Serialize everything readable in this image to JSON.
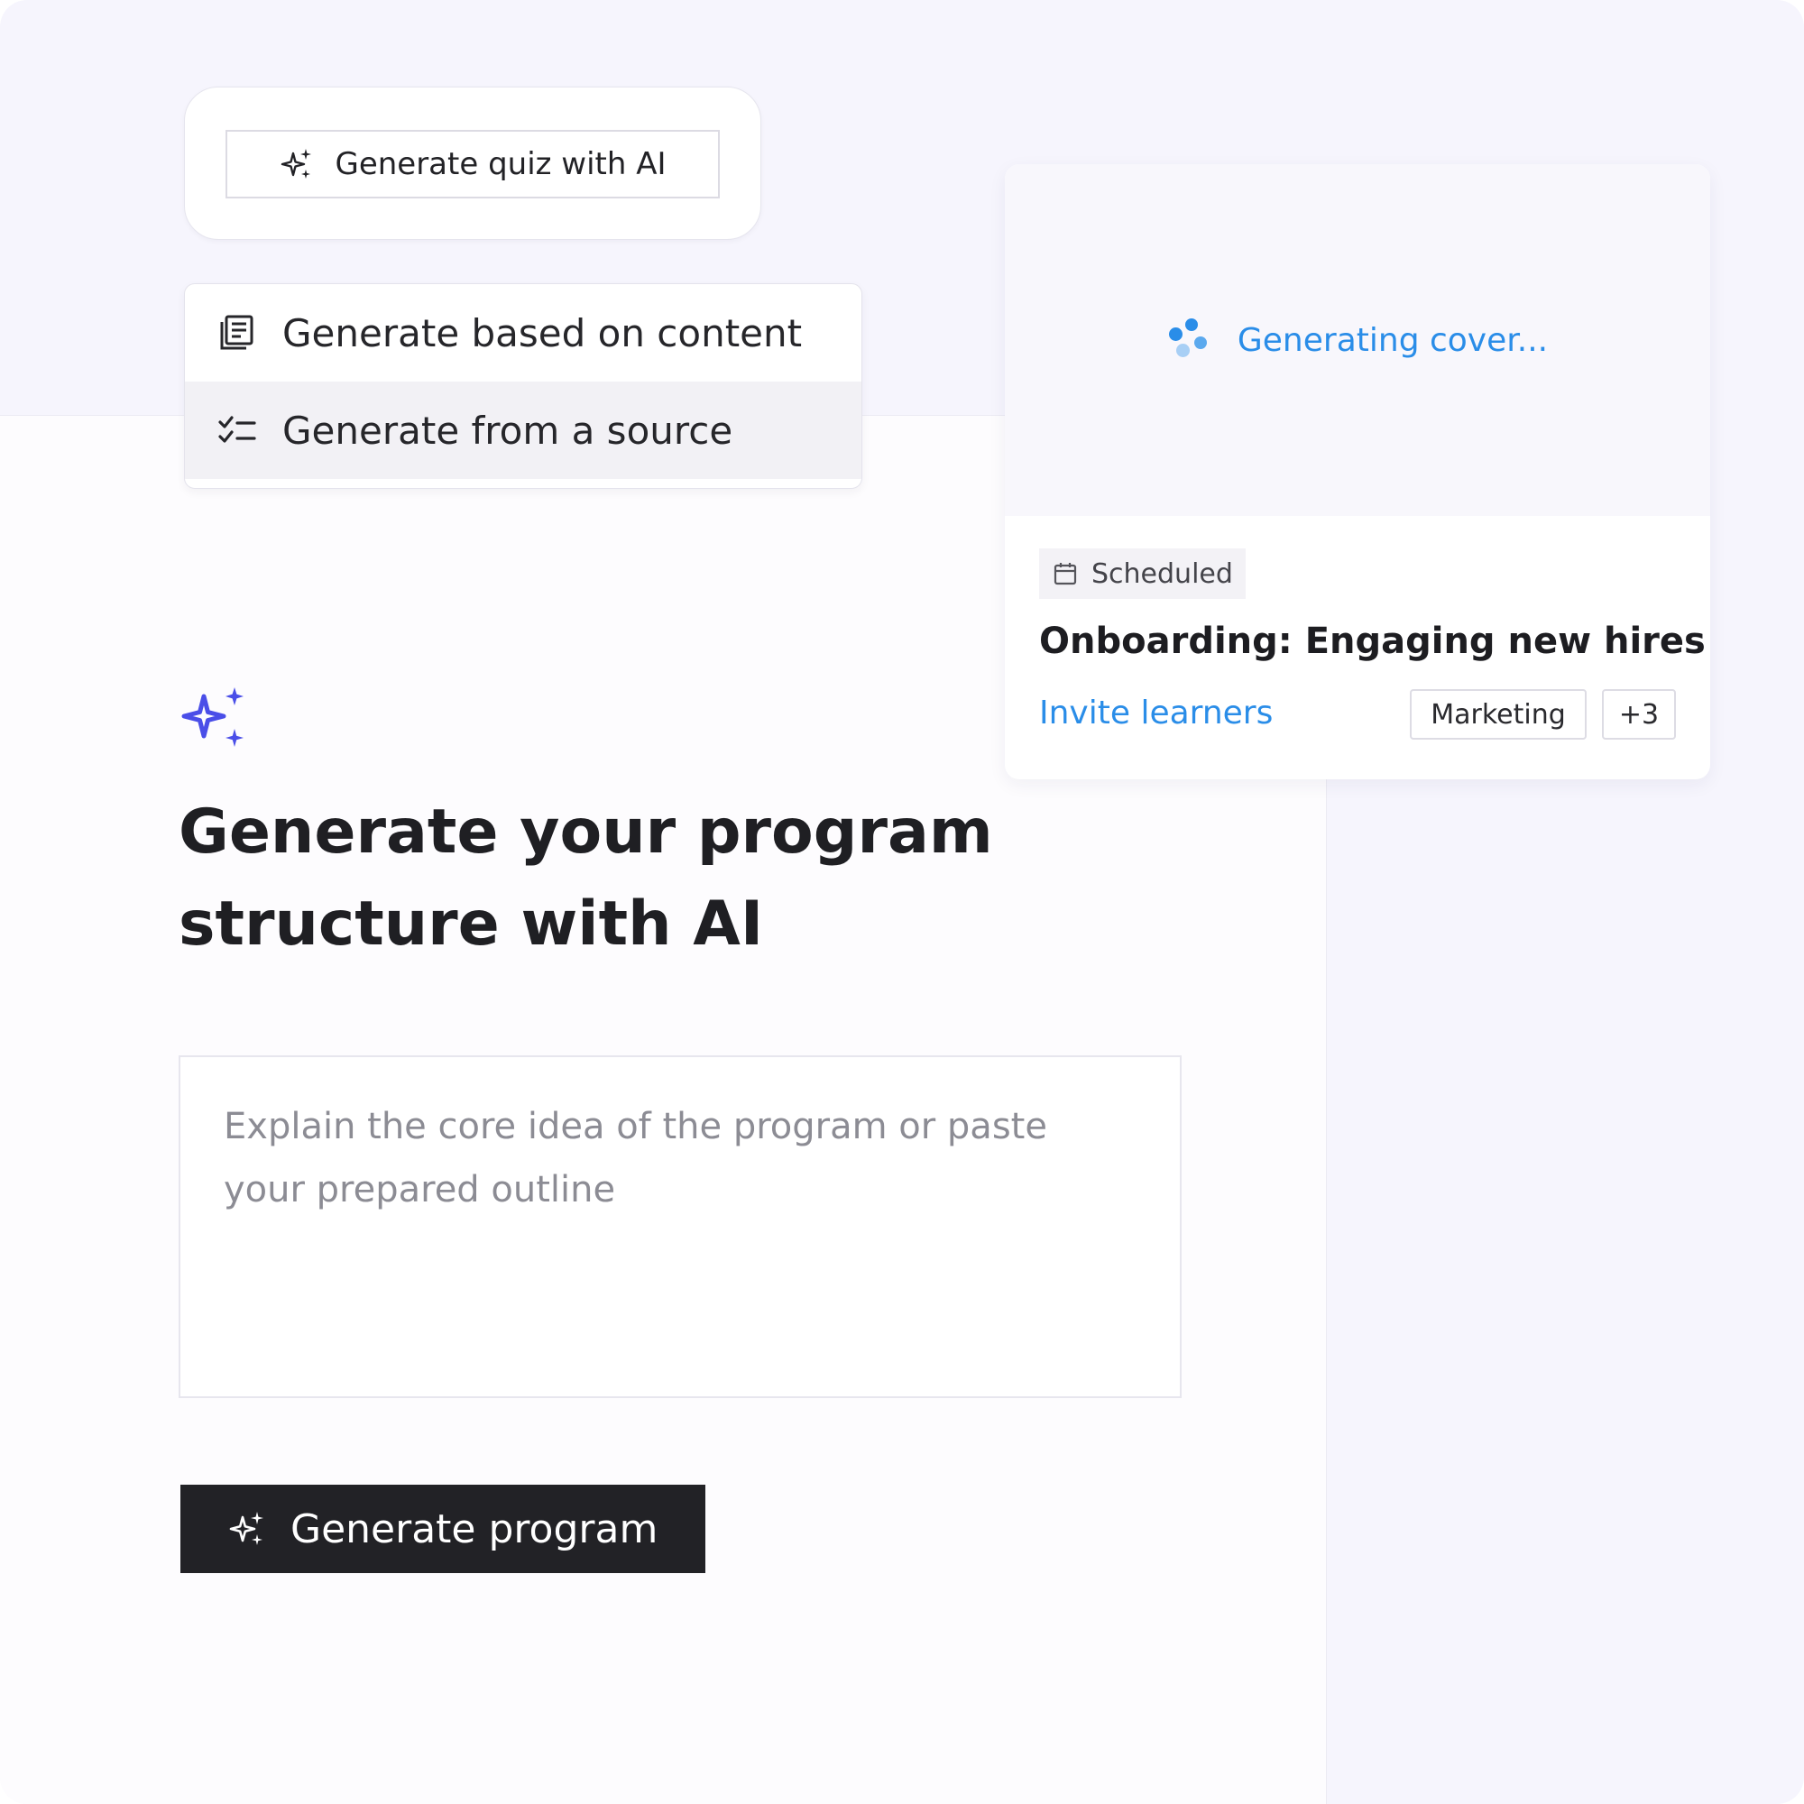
{
  "quiz": {
    "button_label": "Generate quiz with AI",
    "icon": "sparkles-icon"
  },
  "dropdown": {
    "items": [
      {
        "label": "Generate based on content",
        "icon": "document-icon"
      },
      {
        "label": "Generate from a source",
        "icon": "checklist-icon",
        "active": true
      }
    ]
  },
  "course_card": {
    "cover_status": "Generating cover...",
    "badge": "Scheduled",
    "title": "Onboarding: Engaging new hires",
    "invite_link": "Invite learners",
    "tags": [
      "Marketing",
      "+3"
    ]
  },
  "main": {
    "heading_line1": "Generate your program",
    "heading_line2": "structure with AI",
    "prompt_placeholder_line1": "Explain the core idea of the program or paste",
    "prompt_placeholder_line2": "your prepared outline",
    "generate_button": "Generate program"
  },
  "colors": {
    "accent_blue": "#2a8de8",
    "sparkle_indigo": "#4a4ee8",
    "primary_button": "#222226",
    "background": "#f6f5fd"
  }
}
